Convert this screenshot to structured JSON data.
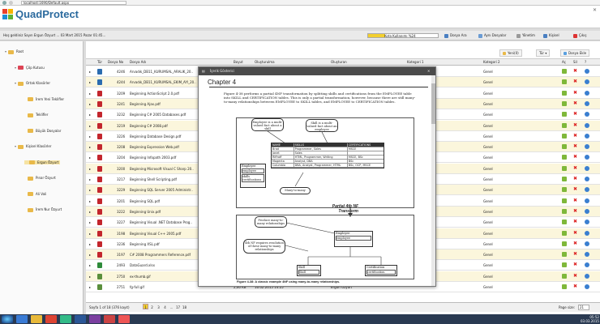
{
  "browser": {
    "url": "localhost:1690/Default.aspx"
  },
  "app": {
    "title": "QuadProtect"
  },
  "infobar": {
    "user": "Hoş geldiniz Sayın Ergun Özyurt  ...  03 Mart 2015 Pazar 01:45...",
    "quota_label": "Kota Kullanımı %24",
    "quota_fraction": 0.24,
    "buttons": [
      "Dosya Ara",
      "Aynı Dosyalar",
      "Yönetim",
      "Kişisel",
      "Çıkış"
    ]
  },
  "tree": [
    {
      "label": "Root",
      "level": 0
    },
    {
      "label": "Çöp Kutusu",
      "level": 1
    },
    {
      "label": "Ortak Klasörler",
      "level": 1
    },
    {
      "label": "İrem Yeni Teklifler",
      "level": 2
    },
    {
      "label": "Teklifler",
      "level": 2
    },
    {
      "label": "Büyük Dosyalar",
      "level": 2
    },
    {
      "label": "Kişisel Klasörler",
      "level": 1
    },
    {
      "label": "Ergun Özyurt",
      "level": 2
    },
    {
      "label": "Pınar Özyurt",
      "level": 2
    },
    {
      "label": "Ali Vali",
      "level": 2
    },
    {
      "label": "İrem Nur Özyurt",
      "level": 2
    }
  ],
  "toolbar": {
    "folder_label": "Yeni(0)",
    "type_label": "Tür",
    "upload_label": "Dosya Ekle"
  },
  "columns": [
    "Tür",
    "Dosya No",
    "Dosya Adı",
    "Boyut",
    "Oluşturulma",
    "Oluşturan",
    "Kategori 1",
    "Kategori 2",
    "Aç",
    "Sil",
    "?"
  ],
  "rows": [
    {
      "no": "4246",
      "name": "Arvadık_DB11_KURUMSAL_ARALIK_20..",
      "cat2": "Genel",
      "type": "doc"
    },
    {
      "no": "4244",
      "name": "Arvadık_DB11_KURUMSAL_EKIM_AYI_20..",
      "cat2": "Genel",
      "type": "doc"
    },
    {
      "no": "3209",
      "name": "Beginning ActionScript 2.0.pdf",
      "cat2": "Genel",
      "type": "pdf"
    },
    {
      "no": "3241",
      "name": "Beginning Ajax.pdf",
      "cat2": "Genel",
      "type": "pdf"
    },
    {
      "no": "3232",
      "name": "Beginning C# 2005 Databases.pdf",
      "cat2": "Genel",
      "type": "pdf"
    },
    {
      "no": "3219",
      "name": "Beginning C# 2008.pdf",
      "cat2": "Genel",
      "type": "pdf"
    },
    {
      "no": "3226",
      "name": "Beginning Database Design.pdf",
      "cat2": "Genel",
      "type": "pdf"
    },
    {
      "no": "3208",
      "name": "Beginning Expression Web.pdf",
      "cat2": "Genel",
      "type": "pdf"
    },
    {
      "no": "3204",
      "name": "Beginning Infopath 2003.pdf",
      "cat2": "Genel",
      "type": "pdf"
    },
    {
      "no": "3200",
      "name": "Beginning Microsoft Visual C Sharp 20..",
      "cat2": "Genel",
      "type": "pdf"
    },
    {
      "no": "3217",
      "name": "Beginning Shell Scripting.pdf",
      "cat2": "Genel",
      "type": "pdf"
    },
    {
      "no": "3229",
      "name": "Beginning SQL Server 2005 Administr..",
      "cat2": "Genel",
      "type": "pdf"
    },
    {
      "no": "3201",
      "name": "Beginning SQL.pdf",
      "cat2": "Genel",
      "type": "pdf"
    },
    {
      "no": "3222",
      "name": "Beginning Unix.pdf",
      "cat2": "Genel",
      "type": "pdf"
    },
    {
      "no": "3227",
      "name": "Beginning Visual .NET Database Prog..",
      "cat2": "Genel",
      "type": "pdf"
    },
    {
      "no": "3198",
      "name": "Beginning Visual C++ 2005.pdf",
      "cat2": "Genel",
      "type": "pdf"
    },
    {
      "no": "3236",
      "name": "Beginning XSL.pdf",
      "cat2": "Genel",
      "type": "pdf"
    },
    {
      "no": "3197",
      "name": "C# 2008 Programmers Reference.pdf",
      "cat2": "Genel",
      "type": "pdf"
    },
    {
      "no": "2493",
      "name": "DataGuard.xlsx",
      "cat2": "Genel",
      "type": "xls"
    },
    {
      "no": "2750",
      "name": "ex-thumb.gif",
      "cat2": "Genel",
      "type": "img"
    },
    {
      "no": "2751",
      "name": "fg-full.gif",
      "size": "2,60 KB",
      "created": "16.02.2015 14:25",
      "owner": "Ergun Özyurt",
      "cat2": "Genel",
      "type": "img"
    }
  ],
  "footer": {
    "pages_label": "Sayfa 1 of 18 (376 kayıt)",
    "pages": [
      "1",
      "2",
      "3",
      "4",
      "...",
      "17",
      "18"
    ],
    "size_label": "Page size:",
    "size_value": "21"
  },
  "viewer": {
    "title": "İçerik Gösterici",
    "chapter": "Chapter 4",
    "paragraph": "Figure 4-38 performs a partial 4NF transformation by splitting skills and certifications from the EMPLOYEE table into SKILL and CERTIFICATION tables. This is only a partial transformation, however, because there are still many-to-many relationships between EMPLOYEE to SKILL tables, and EMPLOYEE to CERTIFICATION tables.",
    "note1": "Employee is a multi-valued fact about a skill",
    "note2": "Skill is a multi-valued fact about an employee",
    "table_headers": [
      "NAME",
      "SKILLS",
      "CERTIFICATIONS"
    ],
    "table_rows": [
      [
        "Brad",
        "Programmer, Sales",
        "MSCE"
      ],
      [
        "Janet",
        "Sales",
        ""
      ],
      [
        "Riffraff",
        "HTML, Programmer, Writing",
        "MSCE, BSc"
      ],
      [
        "Magenta",
        "Analyst, DBA",
        "BSc"
      ],
      [
        "Columbia",
        "DBA, Analyst, Programmer, HTML",
        "BSc, OCP, MSCE"
      ]
    ],
    "entity_title": "Employee",
    "entity_fields": [
      "employee",
      "skills certifications"
    ],
    "mm_label": "Many-to-many",
    "transform_label": "Partial 4th NF Transform",
    "note3": "Produce many-to-many relationships",
    "note4": "4th NF requires resolution of these many-to-many relationships",
    "entity2_title": "Employee",
    "entity2_field": "employee",
    "entity3_title": "Skill",
    "entity3_field": "Skill",
    "entity4_title": "Certification",
    "entity4_field": "certification",
    "caption": "Figure 4-38: A classic example 4NF using many-to-many relationships."
  },
  "taskbar": {
    "time": "05:52",
    "date": "03.03.2015"
  }
}
